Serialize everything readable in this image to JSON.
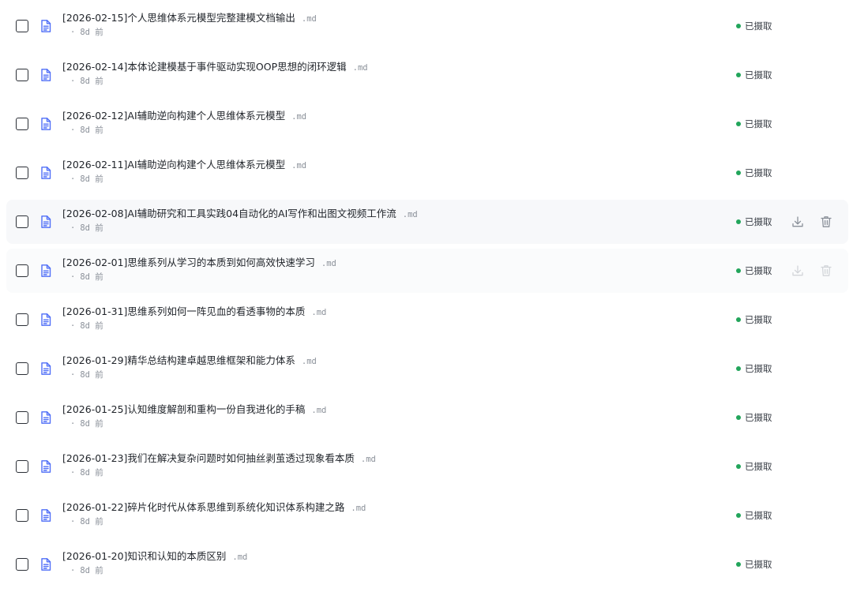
{
  "colors": {
    "status_ok": "#22a55b",
    "file_icon": "#4f6ef7",
    "hover_bg": "#f7f8fa"
  },
  "files": [
    {
      "name": "[2026-02-15]个人思维体系元模型完整建模文档输出",
      "ext": ".md",
      "time": "8d 前",
      "status": "已摄取",
      "actions": false
    },
    {
      "name": "[2026-02-14]本体论建模基于事件驱动实现OOP思想的闭环逻辑",
      "ext": ".md",
      "time": "8d 前",
      "status": "已摄取",
      "actions": false
    },
    {
      "name": "[2026-02-12]AI辅助逆向构建个人思维体系元模型",
      "ext": ".md",
      "time": "8d 前",
      "status": "已摄取",
      "actions": false
    },
    {
      "name": "[2026-02-11]AI辅助逆向构建个人思维体系元模型",
      "ext": ".md",
      "time": "8d 前",
      "status": "已摄取",
      "actions": false
    },
    {
      "name": "[2026-02-08]AI辅助研究和工具实践04自动化的AI写作和出图文视频工作流",
      "ext": ".md",
      "time": "8d 前",
      "status": "已摄取",
      "actions": true,
      "hover": "full"
    },
    {
      "name": "[2026-02-01]思维系列从学习的本质到如何高效快速学习",
      "ext": ".md",
      "time": "8d 前",
      "status": "已摄取",
      "actions": true,
      "hover": "faint"
    },
    {
      "name": "[2026-01-31]思维系列如何一阵见血的看透事物的本质",
      "ext": ".md",
      "time": "8d 前",
      "status": "已摄取",
      "actions": false
    },
    {
      "name": "[2026-01-29]精华总结构建卓越思维框架和能力体系",
      "ext": ".md",
      "time": "8d 前",
      "status": "已摄取",
      "actions": false
    },
    {
      "name": "[2026-01-25]认知维度解剖和重构一份自我进化的手稿",
      "ext": ".md",
      "time": "8d 前",
      "status": "已摄取",
      "actions": false
    },
    {
      "name": "[2026-01-23]我们在解决复杂问题时如何抽丝剥茧透过现象看本质",
      "ext": ".md",
      "time": "8d 前",
      "status": "已摄取",
      "actions": false
    },
    {
      "name": "[2026-01-22]碎片化时代从体系思维到系统化知识体系构建之路",
      "ext": ".md",
      "time": "8d 前",
      "status": "已摄取",
      "actions": false
    },
    {
      "name": "[2026-01-20]知识和认知的本质区别",
      "ext": ".md",
      "time": "8d 前",
      "status": "已摄取",
      "actions": false
    }
  ]
}
